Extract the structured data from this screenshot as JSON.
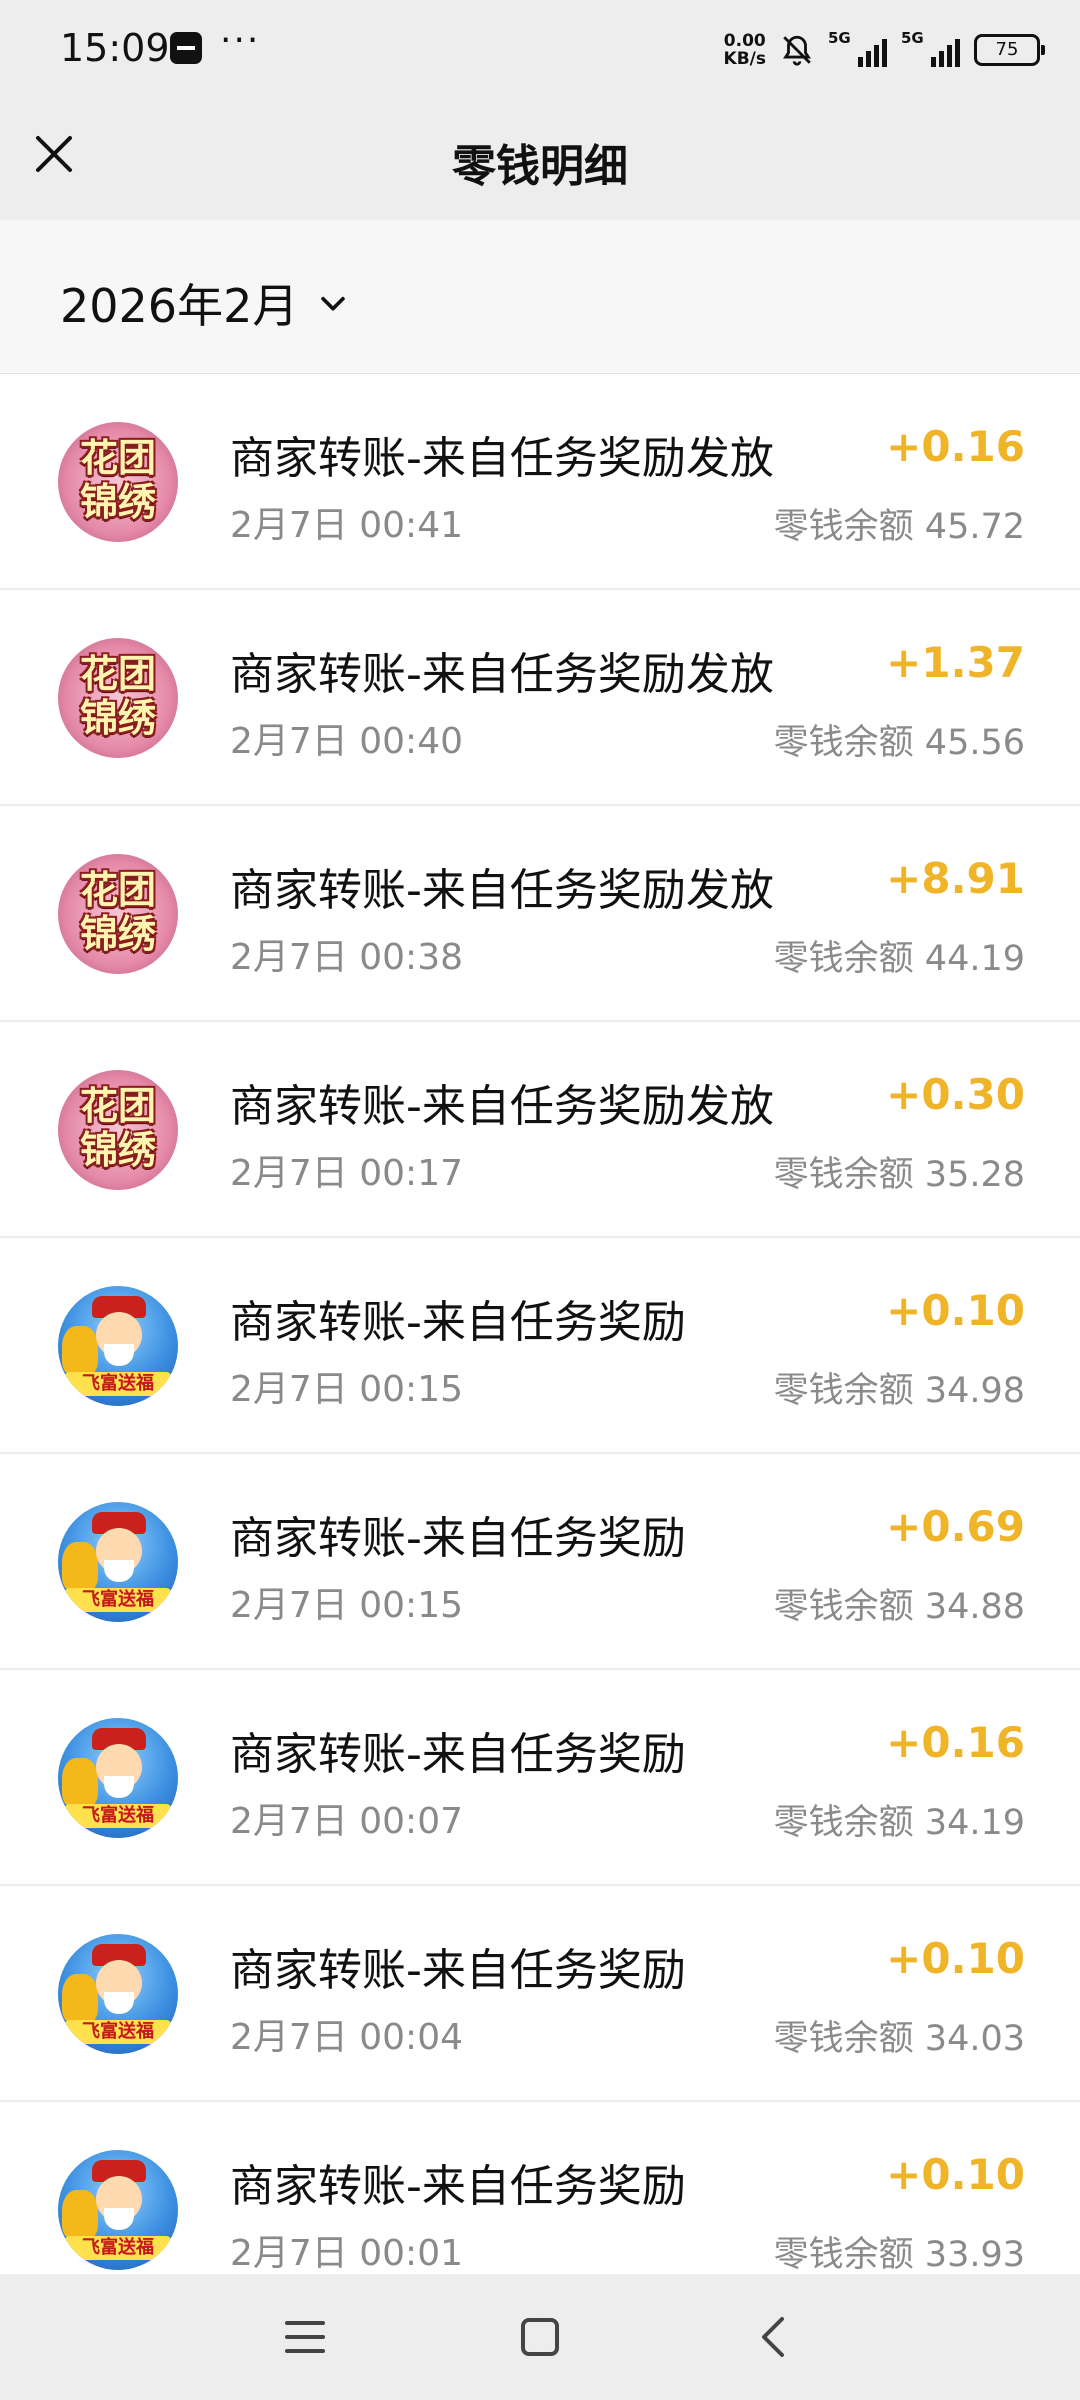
{
  "status_bar": {
    "time": "15:09",
    "dots": "···",
    "net_speed_value": "0.00",
    "net_speed_unit": "KB/s",
    "sim1_label": "5G",
    "sim2_label": "5G",
    "battery": "75"
  },
  "header": {
    "title": "零钱明细"
  },
  "filter": {
    "month": "2026年2月"
  },
  "transactions": [
    {
      "title": "商家转账-来自任务奖励发放",
      "time": "2月7日 00:41",
      "amount": "+0.16",
      "balance": "零钱余额 45.72",
      "avatar": "花团锦绣"
    },
    {
      "title": "商家转账-来自任务奖励发放",
      "time": "2月7日 00:40",
      "amount": "+1.37",
      "balance": "零钱余额 45.56",
      "avatar": "花团锦绣"
    },
    {
      "title": "商家转账-来自任务奖励发放",
      "time": "2月7日 00:38",
      "amount": "+8.91",
      "balance": "零钱余额 44.19",
      "avatar": "花团锦绣"
    },
    {
      "title": "商家转账-来自任务奖励发放",
      "time": "2月7日 00:17",
      "amount": "+0.30",
      "balance": "零钱余额 35.28",
      "avatar": "花团锦绣"
    },
    {
      "title": "商家转账-来自任务奖励",
      "time": "2月7日 00:15",
      "amount": "+0.10",
      "balance": "零钱余额 34.98",
      "avatar": "飞富送福"
    },
    {
      "title": "商家转账-来自任务奖励",
      "time": "2月7日 00:15",
      "amount": "+0.69",
      "balance": "零钱余额 34.88",
      "avatar": "飞富送福"
    },
    {
      "title": "商家转账-来自任务奖励",
      "time": "2月7日 00:07",
      "amount": "+0.16",
      "balance": "零钱余额 34.19",
      "avatar": "飞富送福"
    },
    {
      "title": "商家转账-来自任务奖励",
      "time": "2月7日 00:04",
      "amount": "+0.10",
      "balance": "零钱余额 34.03",
      "avatar": "飞富送福"
    },
    {
      "title": "商家转账-来自任务奖励",
      "time": "2月7日 00:01",
      "amount": "+0.10",
      "balance": "零钱余额 33.93",
      "avatar": "飞富送福"
    }
  ],
  "colors": {
    "amount": "#f0b429",
    "background": "#ededed",
    "secondary_text": "#8a8a8a"
  }
}
